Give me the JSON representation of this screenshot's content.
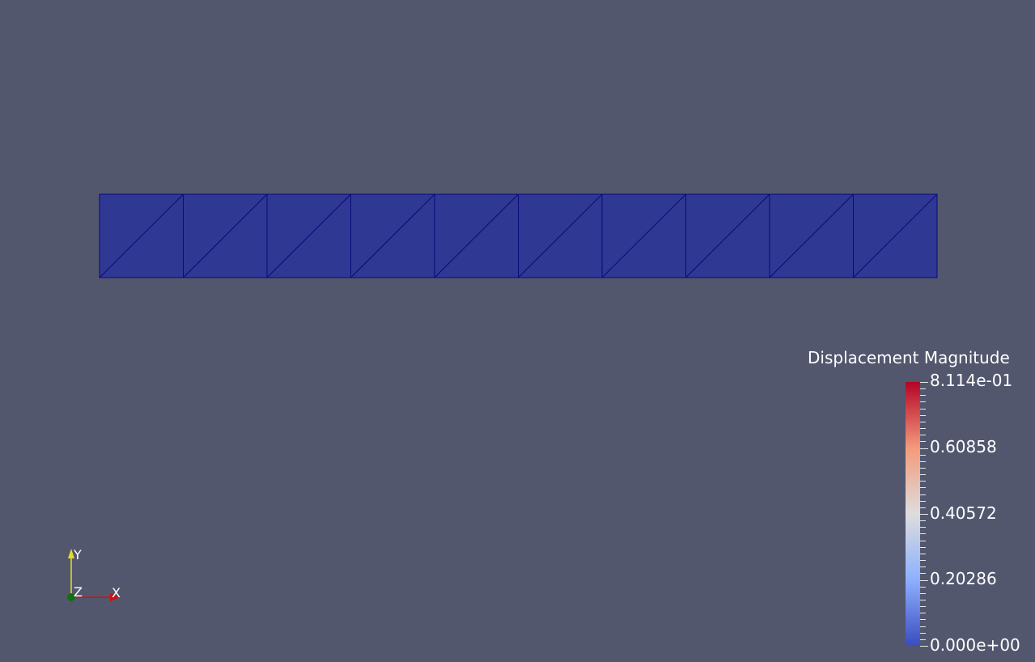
{
  "scene": {
    "background_color": "#52576e",
    "mesh": {
      "cells": 10,
      "fill_color": "#2f3893",
      "edge_color": "#0a0a7a",
      "element_type": "triangle"
    }
  },
  "scalar_bar": {
    "title": "Displacement Magnitude",
    "labels": {
      "max": "8.114e-01",
      "t3": "0.60858",
      "t2": "0.40572",
      "t1": "0.20286",
      "min": "0.000e+00"
    },
    "colormap": [
      "#3b4cc0",
      "#8db0fe",
      "#dddddd",
      "#f49a7b",
      "#b40426"
    ]
  },
  "orientation_axes": {
    "x_label": "X",
    "y_label": "Y",
    "z_label": "Z",
    "x_color": "#d01010",
    "y_color": "#e0e020",
    "z_color": "#107010"
  }
}
